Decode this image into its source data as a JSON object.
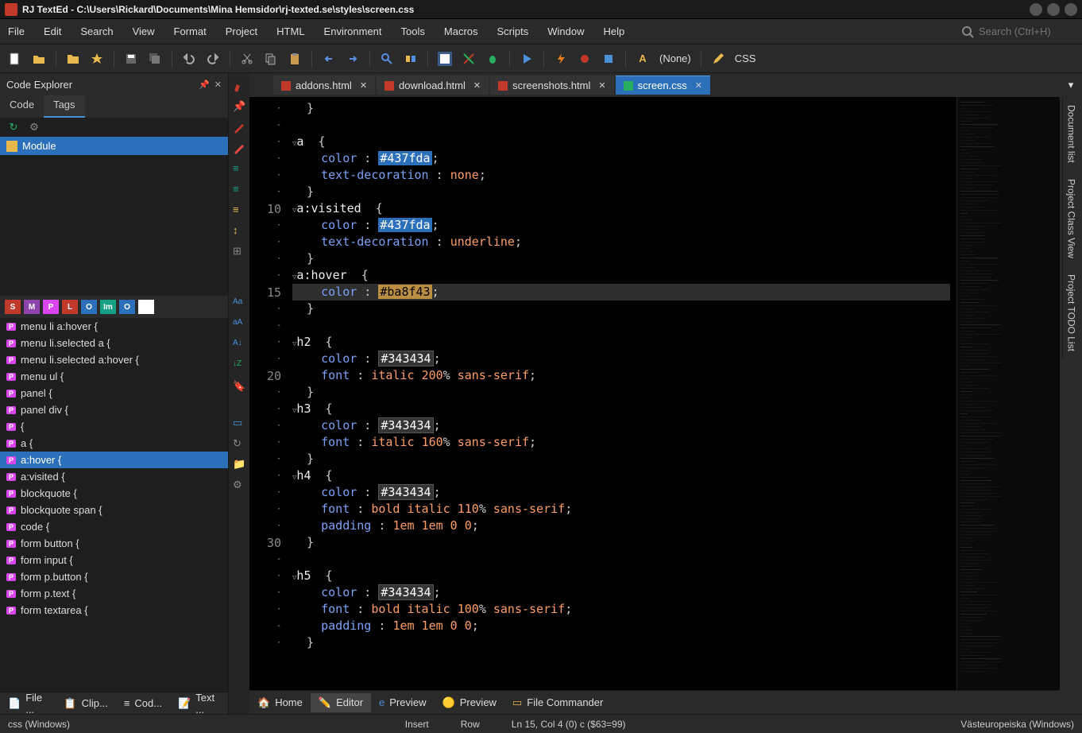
{
  "titlebar": {
    "title": "RJ TextEd - C:\\Users\\Rickard\\Documents\\Mina Hemsidor\\rj-texted.se\\styles\\screen.css"
  },
  "menubar": {
    "items": [
      "File",
      "Edit",
      "Search",
      "View",
      "Format",
      "Project",
      "HTML",
      "Environment",
      "Tools",
      "Macros",
      "Scripts",
      "Window",
      "Help"
    ],
    "search_placeholder": "Search (Ctrl+H)"
  },
  "toolbar": {
    "dropdown1": "(None)",
    "dropdown2": "CSS"
  },
  "code_explorer": {
    "title": "Code Explorer",
    "tabs": [
      "Code",
      "Tags"
    ],
    "active_tab": 1,
    "tree": [
      "Module"
    ],
    "filter_buttons": [
      "S",
      "M",
      "P",
      "L",
      "O",
      "Im",
      "O"
    ],
    "css_rules": [
      "menu li a:hover {",
      "menu li.selected a {",
      "menu li.selected a:hover {",
      "menu ul {",
      "panel {",
      "panel div {",
      "{",
      "a {",
      "a:hover {",
      "a:visited {",
      "blockquote {",
      "blockquote span {",
      "code {",
      "form button {",
      "form input {",
      "form p.button {",
      "form p.text {",
      "form textarea {"
    ],
    "selected_rule": 8
  },
  "tabs": [
    {
      "label": "addons.html",
      "active": false
    },
    {
      "label": "download.html",
      "active": false
    },
    {
      "label": "screenshots.html",
      "active": false
    },
    {
      "label": "screen.css",
      "active": true
    }
  ],
  "code": {
    "lines": [
      {
        "n": "",
        "dot": "·",
        "fold": "",
        "text": "  }",
        "cls": ""
      },
      {
        "n": "",
        "dot": "-",
        "fold": "",
        "text": "",
        "cls": ""
      },
      {
        "n": "",
        "dot": "·",
        "fold": "▽",
        "text": "a  {",
        "cls": "sel"
      },
      {
        "n": "",
        "dot": "·",
        "fold": "",
        "text": "    color : ",
        "prop": true,
        "hex": "#437fda",
        "after": ";",
        "cls": ""
      },
      {
        "n": "",
        "dot": "·",
        "fold": "",
        "text": "    text-decoration : ",
        "prop": true,
        "val": "none",
        "after": ";",
        "cls": ""
      },
      {
        "n": "",
        "dot": "·",
        "fold": "",
        "text": "  }",
        "cls": ""
      },
      {
        "n": "10",
        "dot": "",
        "fold": "▽",
        "text": "a:visited  {",
        "cls": "sel"
      },
      {
        "n": "",
        "dot": "·",
        "fold": "",
        "text": "    color : ",
        "prop": true,
        "hex": "#437fda",
        "after": ";",
        "cls": ""
      },
      {
        "n": "",
        "dot": "·",
        "fold": "",
        "text": "    text-decoration : ",
        "prop": true,
        "val": "underline",
        "after": ";",
        "cls": ""
      },
      {
        "n": "",
        "dot": "·",
        "fold": "",
        "text": "  }",
        "cls": ""
      },
      {
        "n": "",
        "dot": "·",
        "fold": "▽",
        "text": "a:hover  {",
        "cls": "sel"
      },
      {
        "n": "15",
        "dot": "",
        "fold": "",
        "text": "    color : ",
        "prop": true,
        "hex2": "#ba8f43",
        "after": ";",
        "current": true
      },
      {
        "n": "",
        "dot": "·",
        "fold": "",
        "text": "  }",
        "cls": ""
      },
      {
        "n": "",
        "dot": "-",
        "fold": "",
        "text": "",
        "cls": ""
      },
      {
        "n": "",
        "dot": "·",
        "fold": "▽",
        "text": "h2  {",
        "cls": "sel"
      },
      {
        "n": "",
        "dot": "·",
        "fold": "",
        "text": "    color : ",
        "prop": true,
        "hex3": "#343434",
        "after": ";",
        "cls": ""
      },
      {
        "n": "20",
        "dot": "",
        "fold": "",
        "text": "    font : ",
        "prop": true,
        "val": "italic ",
        "num": "200",
        "pct": "% ",
        "val2": "sans-serif",
        "after": ";",
        "cls": ""
      },
      {
        "n": "",
        "dot": "·",
        "fold": "",
        "text": "  }",
        "cls": ""
      },
      {
        "n": "",
        "dot": "·",
        "fold": "▽",
        "text": "h3  {",
        "cls": "sel"
      },
      {
        "n": "",
        "dot": "·",
        "fold": "",
        "text": "    color : ",
        "prop": true,
        "hex3": "#343434",
        "after": ";",
        "cls": ""
      },
      {
        "n": "",
        "dot": "·",
        "fold": "",
        "text": "    font : ",
        "prop": true,
        "val": "italic ",
        "num": "160",
        "pct": "% ",
        "val2": "sans-serif",
        "after": ";",
        "cls": ""
      },
      {
        "n": "",
        "dot": "·",
        "fold": "",
        "text": "  }",
        "cls": ""
      },
      {
        "n": "",
        "dot": "·",
        "fold": "▽",
        "text": "h4  {",
        "cls": "sel"
      },
      {
        "n": "",
        "dot": "·",
        "fold": "",
        "text": "    color : ",
        "prop": true,
        "hex3": "#343434",
        "after": ";",
        "cls": ""
      },
      {
        "n": "",
        "dot": "·",
        "fold": "",
        "text": "    font : ",
        "prop": true,
        "val": "bold italic ",
        "num": "110",
        "pct": "% ",
        "val2": "sans-serif",
        "after": ";",
        "cls": ""
      },
      {
        "n": "",
        "dot": "·",
        "fold": "",
        "text": "    padding : ",
        "prop": true,
        "val": "1em 1em 0 0",
        "after": ";",
        "cls": ""
      },
      {
        "n": "30",
        "dot": "",
        "fold": "",
        "text": "  }",
        "cls": ""
      },
      {
        "n": "",
        "dot": "-",
        "fold": "",
        "text": "",
        "cls": ""
      },
      {
        "n": "",
        "dot": "·",
        "fold": "▽",
        "text": "h5  {",
        "cls": "sel"
      },
      {
        "n": "",
        "dot": "·",
        "fold": "",
        "text": "    color : ",
        "prop": true,
        "hex3": "#343434",
        "after": ";",
        "cls": ""
      },
      {
        "n": "",
        "dot": "·",
        "fold": "",
        "text": "    font : ",
        "prop": true,
        "val": "bold italic ",
        "num": "100",
        "pct": "% ",
        "val2": "sans-serif",
        "after": ";",
        "cls": ""
      },
      {
        "n": "",
        "dot": "-",
        "fold": "",
        "text": "    padding : ",
        "prop": true,
        "val": "1em 1em 0 0",
        "after": ";",
        "cls": ""
      },
      {
        "n": "",
        "dot": "·",
        "fold": "",
        "text": "  }",
        "cls": ""
      }
    ]
  },
  "right_rail": [
    "Document list",
    "Project Class View",
    "Project TODO List"
  ],
  "left_bottom_tabs": [
    "File ...",
    "Clip...",
    "Cod...",
    "Text ..."
  ],
  "bottom_tabs": [
    {
      "icon": "home",
      "label": "Home"
    },
    {
      "icon": "editor",
      "label": "Editor"
    },
    {
      "icon": "ie",
      "label": "Preview"
    },
    {
      "icon": "chrome",
      "label": "Preview"
    },
    {
      "icon": "fc",
      "label": "File Commander"
    }
  ],
  "bottom_active": 1,
  "status": {
    "lang": "css (Windows)",
    "ins": "Insert",
    "row": "Row",
    "pos": "Ln 15, Col 4 (0) c ($63=99)",
    "enc": "Västeuropeiska (Windows)"
  }
}
